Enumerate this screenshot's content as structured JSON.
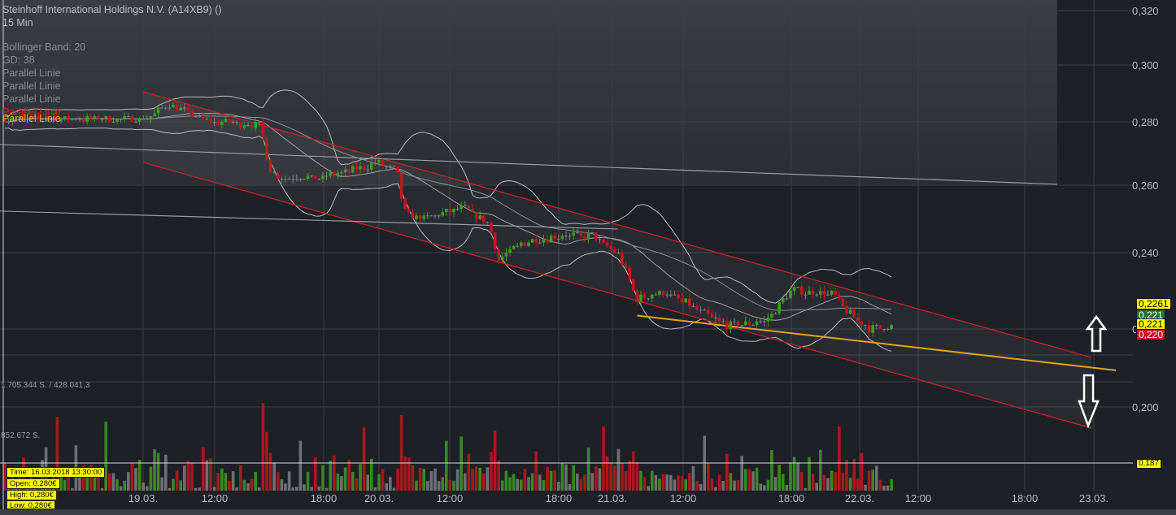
{
  "legend": {
    "title": "Steinhoff International Holdings N.V. (A14XB9) ()",
    "interval": "15 Min",
    "indicators": [
      "Bollinger Band: 20",
      "GD: 38",
      "Parallel Linie",
      "Parallel Linie",
      "Parallel Linie",
      "Parallel Linie",
      "Parallel Linie"
    ]
  },
  "volume_labels": {
    "top": "1.705.344 S. / 428.041,3",
    "mid": "852.672 S."
  },
  "tooltip": {
    "time": "Time: 16.03.2018 13:30:00",
    "open": "Open: 0,280€",
    "high": "High: 0,280€",
    "low": "Low: 0,280€"
  },
  "price_boxes": [
    {
      "text": "0,2261",
      "bg": "#ffff00",
      "fg": "#000000"
    },
    {
      "text": "0,221",
      "bg": "#1f7a1f",
      "fg": "#ffffff"
    },
    {
      "text": "0,221",
      "bg": "#ffff00",
      "fg": "#000000"
    },
    {
      "text": "0,220",
      "bg": "#c8102e",
      "fg": "#ffffff"
    }
  ],
  "volume_marker": "0,187",
  "colors": {
    "up": "#3d9b22",
    "down": "#c1161e",
    "channel": "#d0202a",
    "support": "#e8a317",
    "neutral": "#7b7e83"
  },
  "chart_data": {
    "type": "candlestick",
    "title": "Steinhoff International Holdings N.V. (A14XB9) ()",
    "interval": "15 Min",
    "y_ticks": [
      {
        "label": "0,320",
        "value": 0.32
      },
      {
        "label": "0,300",
        "value": 0.3
      },
      {
        "label": "0,280",
        "value": 0.28
      },
      {
        "label": "0,260",
        "value": 0.26
      },
      {
        "label": "0,240",
        "value": 0.24
      },
      {
        "label": "0,220",
        "value": 0.22
      },
      {
        "label": "0,200",
        "value": 0.2
      }
    ],
    "x_ticks": [
      {
        "label": "19.03.",
        "t": 8
      },
      {
        "label": "12:00",
        "t": 12
      },
      {
        "label": "18:00",
        "t": 18
      },
      {
        "label": "20.03.",
        "t": 32
      },
      {
        "label": "12:00",
        "t": 36
      },
      {
        "label": "18:00",
        "t": 42
      },
      {
        "label": "21.03.",
        "t": 56
      },
      {
        "label": "12:00",
        "t": 60
      },
      {
        "label": "18:00",
        "t": 66
      },
      {
        "label": "22.03.",
        "t": 80
      },
      {
        "label": "12:00",
        "t": 84
      },
      {
        "label": "18:00",
        "t": 90
      },
      {
        "label": "23.03.",
        "t": 104
      }
    ],
    "price_path": [
      [
        2,
        0.281
      ],
      [
        8,
        0.281
      ],
      [
        9.5,
        0.286
      ],
      [
        11.8,
        0.28
      ],
      [
        14.5,
        0.279
      ],
      [
        15,
        0.265
      ],
      [
        15.6,
        0.262
      ],
      [
        19.5,
        0.263
      ],
      [
        32,
        0.267
      ],
      [
        33,
        0.265
      ],
      [
        33.4,
        0.252
      ],
      [
        34.5,
        0.25
      ],
      [
        36.8,
        0.253
      ],
      [
        38.2,
        0.248
      ],
      [
        38.7,
        0.238
      ],
      [
        40,
        0.243
      ],
      [
        42,
        0.245
      ],
      [
        51,
        0.245
      ],
      [
        56.3,
        0.24
      ],
      [
        57.4,
        0.228
      ],
      [
        58.8,
        0.23
      ],
      [
        60,
        0.227
      ],
      [
        62.4,
        0.221
      ],
      [
        64.6,
        0.222
      ],
      [
        66,
        0.23
      ],
      [
        75,
        0.229
      ],
      [
        77,
        0.225
      ],
      [
        81,
        0.22
      ],
      [
        82.5,
        0.221
      ]
    ],
    "bollinger_period": 20,
    "gd_period": 38,
    "lines": [
      {
        "name": "channel-upper",
        "color": "#d0202a",
        "from": [
          8,
          0.2906
        ],
        "to": [
          103.5,
          0.2127
        ]
      },
      {
        "name": "channel-lower",
        "color": "#d0202a",
        "from": [
          8,
          0.2672
        ],
        "to": [
          103.5,
          0.1951
        ]
      },
      {
        "name": "parallel-gray-1",
        "color": "#9a9da2",
        "from": [
          1,
          0.2731
        ],
        "to": [
          96.6,
          0.2603
        ]
      },
      {
        "name": "parallel-gray-2",
        "color": "#9a9da2",
        "from": [
          1,
          0.2525
        ],
        "to": [
          56.3,
          0.247
        ]
      },
      {
        "name": "support-line",
        "color": "#e8a317",
        "from": [
          57.4,
          0.2235
        ],
        "to": [
          107.6,
          0.2094
        ]
      }
    ],
    "volume_max_label": "1.705.344 S.",
    "volume_mid_label": "852.672 S.",
    "last_price": 0.22
  }
}
